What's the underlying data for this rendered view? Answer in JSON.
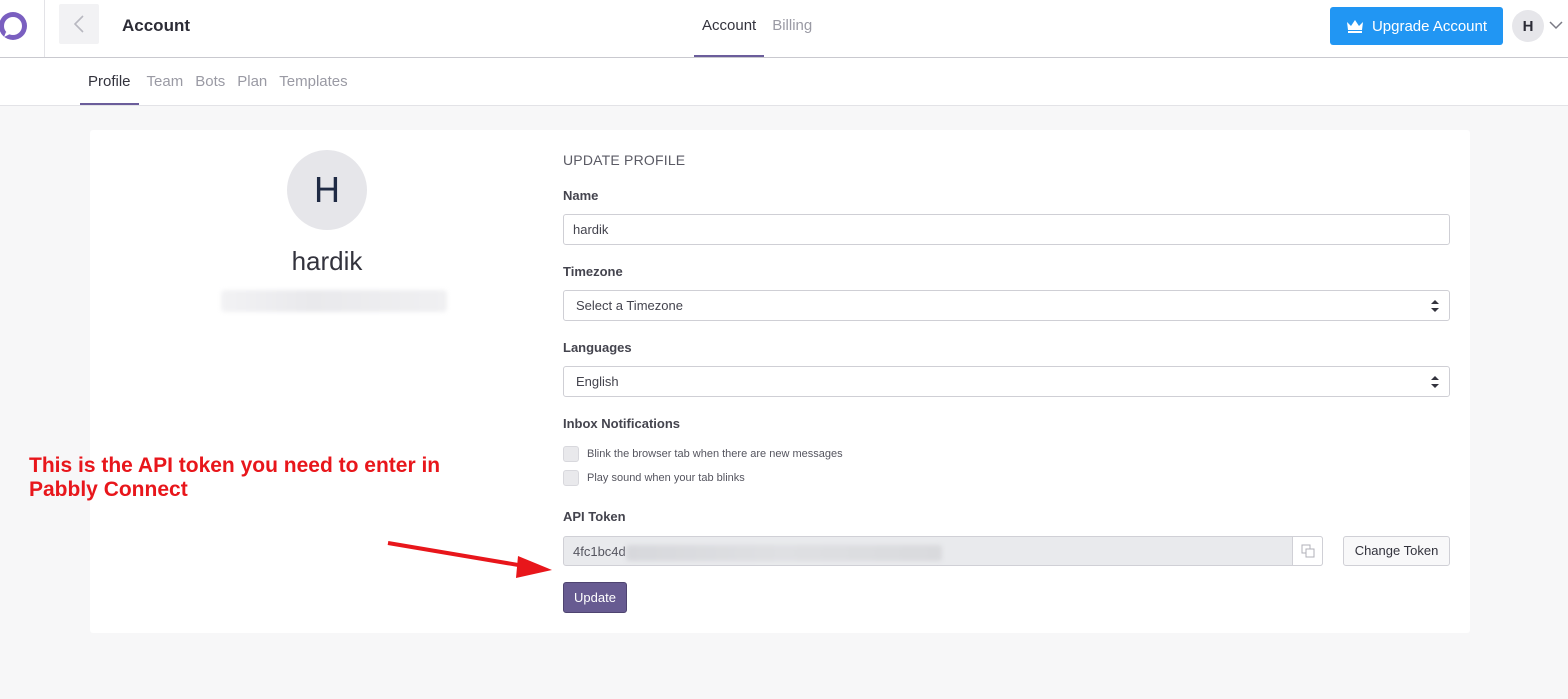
{
  "header": {
    "title": "Account",
    "tabs": [
      {
        "label": "Account",
        "active": true
      },
      {
        "label": "Billing",
        "active": false
      }
    ],
    "upgrade_label": "Upgrade Account",
    "user_initial": "H",
    "accent_color": "#2196f3"
  },
  "subnav": {
    "tabs": [
      {
        "label": "Profile",
        "active": true
      },
      {
        "label": "Team",
        "active": false
      },
      {
        "label": "Bots",
        "active": false
      },
      {
        "label": "Plan",
        "active": false
      },
      {
        "label": "Templates",
        "active": false
      }
    ]
  },
  "profile": {
    "initial": "H",
    "name": "hardik"
  },
  "form": {
    "section_title": "UPDATE PROFILE",
    "name_label": "Name",
    "name_value": "hardik",
    "timezone_label": "Timezone",
    "timezone_value": "Select a Timezone",
    "languages_label": "Languages",
    "language_value": "English",
    "notifications_label": "Inbox Notifications",
    "notifications": [
      {
        "label": "Blink the browser tab when there are new messages",
        "checked": false
      },
      {
        "label": "Play sound when your tab blinks",
        "checked": false
      }
    ],
    "api_token_label": "API Token",
    "api_token_visible": "4fc1bc4d",
    "change_token_label": "Change Token",
    "update_label": "Update"
  },
  "annotation": {
    "line1": "This is the API token you need to enter in",
    "line2": "Pabbly Connect",
    "color": "#e8161b"
  },
  "icons": [
    "logo-icon",
    "back-arrow-icon",
    "crown-icon",
    "chevron-down-icon",
    "select-arrows-icon",
    "copy-icon"
  ]
}
